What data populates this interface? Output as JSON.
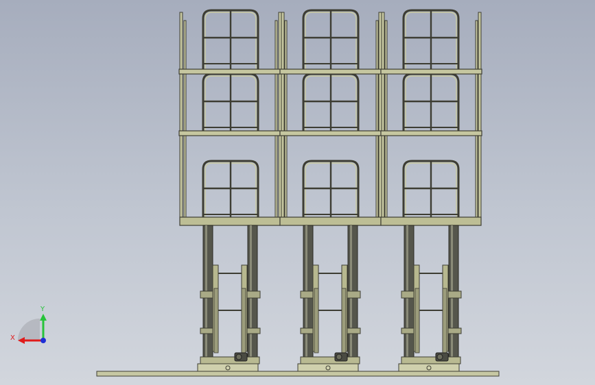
{
  "triad": {
    "x_label": "X",
    "y_label": "Y",
    "x_color": "#e01b1b",
    "y_color": "#27c33a",
    "z_color": "#1f2fd6"
  },
  "model": {
    "frame_color": "#b8b98e",
    "edge_color": "#3d3d33",
    "column_color": "#53544a",
    "background_top": "#a6adbd",
    "background_bottom": "#d2d6dd"
  }
}
